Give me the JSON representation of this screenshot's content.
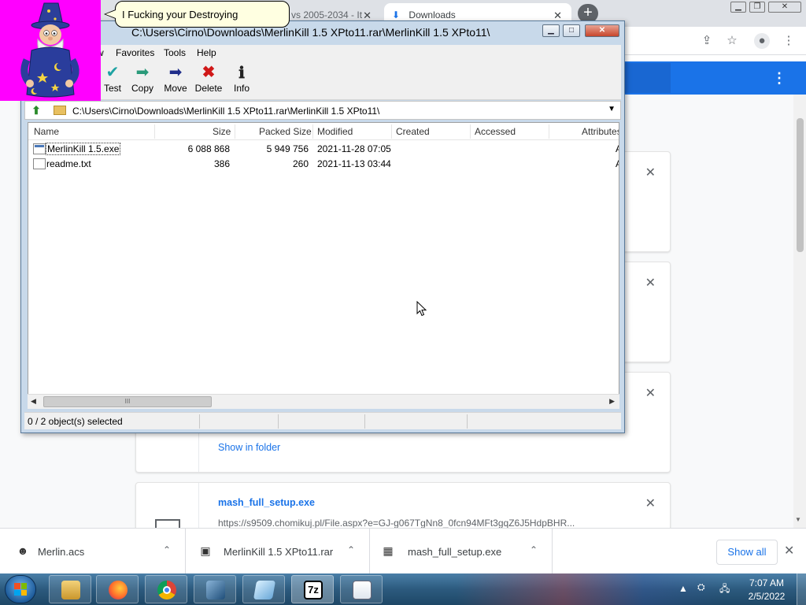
{
  "chrome": {
    "tabs": [
      {
        "label": "vs 2005-2034 - It"
      },
      {
        "label": "Downloads"
      }
    ],
    "new_tab": "+",
    "download_cards": [
      {
        "action_label": "Show in folder"
      },
      {
        "title": "mash_full_setup.exe",
        "url": "https://s9509.chomikuj.pl/File.aspx?e=GJ-g067TgNn8_0fcn94MFt3gqZ6J5HdpBHR..."
      }
    ],
    "shelf": {
      "items": [
        {
          "name": "Merlin.acs",
          "icon": "merlin-file-icon"
        },
        {
          "name": "MerlinKill 1.5 XPto11.rar",
          "icon": "rar-archive-icon"
        },
        {
          "name": "mash_full_setup.exe",
          "icon": "installer-icon"
        }
      ],
      "show_all": "Show all"
    }
  },
  "zip": {
    "title": "C:\\Users\\Cirno\\Downloads\\MerlinKill 1.5 XPto11.rar\\MerlinKill 1.5 XPto11\\",
    "menu": [
      "w",
      "Favorites",
      "Tools",
      "Help"
    ],
    "toolbar": [
      {
        "label": "Test",
        "icon": "test-icon"
      },
      {
        "label": "Copy",
        "icon": "copy-icon"
      },
      {
        "label": "Move",
        "icon": "move-icon"
      },
      {
        "label": "Delete",
        "icon": "delete-icon"
      },
      {
        "label": "Info",
        "icon": "info-icon"
      }
    ],
    "address": "C:\\Users\\Cirno\\Downloads\\MerlinKill 1.5 XPto11.rar\\MerlinKill 1.5 XPto11\\",
    "columns": [
      "Name",
      "Size",
      "Packed Size",
      "Modified",
      "Created",
      "Accessed",
      "Attributes"
    ],
    "rows": [
      {
        "name": "MerlinKill 1.5.exe",
        "size": "6 088 868",
        "packed": "5 949 756",
        "modified": "2021-11-28 07:05",
        "attr": "A"
      },
      {
        "name": "readme.txt",
        "size": "386",
        "packed": "260",
        "modified": "2021-11-13 03:44",
        "attr": "A"
      }
    ],
    "scroll_grip": "III",
    "status": "0 / 2 object(s) selected"
  },
  "merlin": {
    "speech": "I Fucking your Destroying"
  },
  "taskbar": {
    "time": "7:07 AM",
    "date": "2/5/2022",
    "apps": [
      "file-explorer-icon",
      "firefox-icon",
      "chrome-icon",
      "virtualbox-icon",
      "notepad-icon",
      "7zip-icon",
      "folder-icon"
    ],
    "sevenzip_label": "7z"
  },
  "colors": {
    "merlin_background": "#ff00ff",
    "chrome_accent": "#1a73e8",
    "taskbar": "#2c5a7e"
  }
}
